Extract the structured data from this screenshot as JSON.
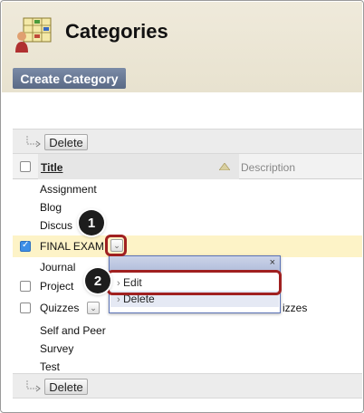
{
  "header": {
    "title": "Categories",
    "create_button": "Create Category"
  },
  "action_bar": {
    "delete_label": "Delete"
  },
  "table": {
    "columns": {
      "title": "Title",
      "description": "Description"
    },
    "rows": [
      {
        "label": "Assignment"
      },
      {
        "label": "Blog"
      },
      {
        "label": "Discus"
      },
      {
        "label": "FINAL EXAM",
        "checked": true
      },
      {
        "label": "Journal"
      },
      {
        "label": "Project"
      },
      {
        "label": "Quizzes",
        "desc": "izzes"
      },
      {
        "label": "Self and Peer"
      },
      {
        "label": "Survey"
      },
      {
        "label": "Test"
      }
    ]
  },
  "popup": {
    "close": "×",
    "items": [
      "Edit",
      "Delete"
    ]
  },
  "callouts": [
    "1",
    "2"
  ],
  "colors": {
    "accent_button": "#6b7b97",
    "highlight_row": "#fdf3c7",
    "callout_border": "#a02020"
  }
}
